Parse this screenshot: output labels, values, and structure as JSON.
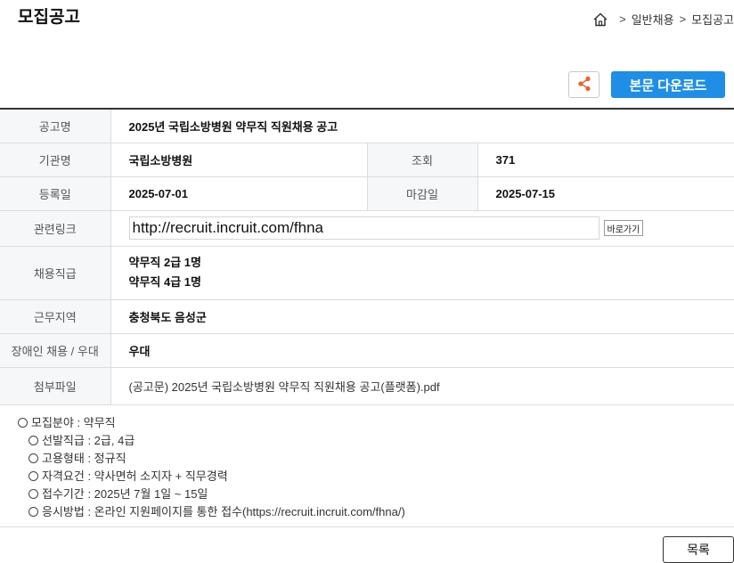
{
  "header": {
    "title": "모집공고",
    "breadcrumb": {
      "sep1": ">",
      "item1": "일반채용",
      "sep2": ">",
      "item2": "모집공고"
    }
  },
  "actions": {
    "share_icon": "share-icon",
    "download_label": "본문 다운로드"
  },
  "info": {
    "title_label": "공고명",
    "title_value": "2025년 국립소방병원 약무직 직원채용 공고",
    "org_label": "기관명",
    "org_value": "국립소방병원",
    "views_label": "조회",
    "views_value": "371",
    "reg_label": "등록일",
    "reg_value": "2025-07-01",
    "deadline_label": "마감일",
    "deadline_value": "2025-07-15",
    "link_label": "관련링크",
    "link_value": "http://recruit.incruit.com/fhna",
    "link_go": "바로가기",
    "grade_label": "채용직급",
    "grade_values": [
      "약무직 2급 1명",
      "약무직 4급 1명"
    ],
    "region_label": "근무지역",
    "region_value": "충청북도 음성군",
    "disabled_label": "장애인 채용 / 우대",
    "disabled_value": "우대",
    "attach_label": "첨부파일",
    "attach_value": "(공고문) 2025년 국립소방병원 약무직 직원채용 공고(플랫폼).pdf"
  },
  "details": {
    "field": "모집분야 : 약무직",
    "items": [
      "선발직급 : 2급, 4급",
      "고용형태 : 정규직",
      "자격요건 : 약사면허 소지자 + 직무경력",
      "접수기간 : 2025년 7월 1일 ~ 15일",
      "응시방법 : 온라인 지원페이지를 통한 접수(https://recruit.incruit.com/fhna/)"
    ]
  },
  "footer": {
    "list_label": "목록"
  },
  "colors": {
    "accent": "#1f8ee6",
    "share_icon": "#e8602c",
    "header_cell_bg": "#f6f7f9"
  }
}
